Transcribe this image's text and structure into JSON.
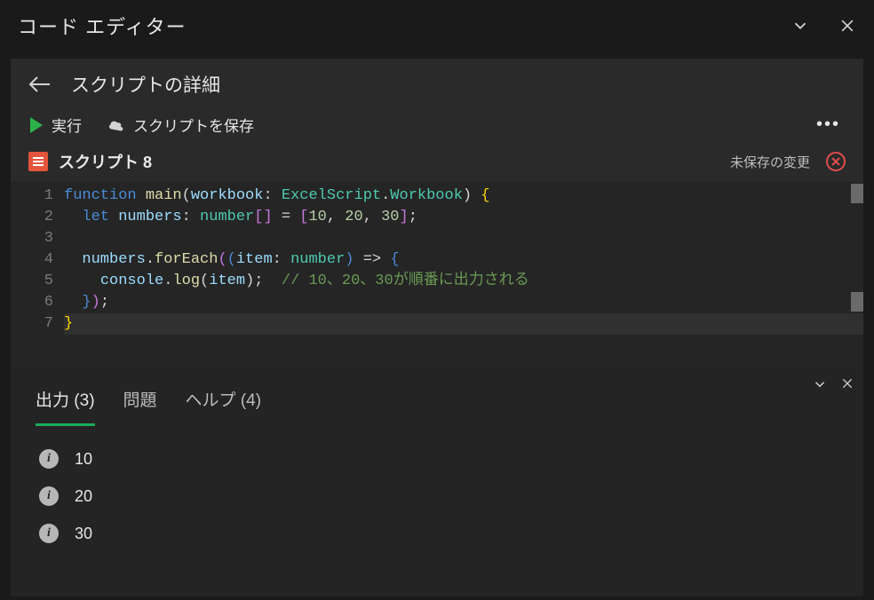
{
  "window": {
    "title": "コード エディター"
  },
  "header": {
    "title": "スクリプトの詳細",
    "run_label": "実行",
    "save_label": "スクリプトを保存"
  },
  "script": {
    "name": "スクリプト 8",
    "unsaved_label": "未保存の変更"
  },
  "code": {
    "line_numbers": [
      "1",
      "2",
      "3",
      "4",
      "5",
      "6",
      "7"
    ],
    "lines": [
      {
        "t": "function main(workbook: ExcelScript.Workbook) {"
      },
      {
        "t": "  let numbers: number[] = [10, 20, 30];"
      },
      {
        "t": ""
      },
      {
        "t": "  numbers.forEach((item: number) => {"
      },
      {
        "t": "    console.log(item);  // 10、20、30が順番に出力される"
      },
      {
        "t": "  });"
      },
      {
        "t": "}"
      }
    ]
  },
  "panel": {
    "tabs": {
      "output": {
        "label": "出力",
        "count": 3
      },
      "problems": {
        "label": "問題"
      },
      "help": {
        "label": "ヘルプ",
        "count": 4
      }
    },
    "output_items": [
      "10",
      "20",
      "30"
    ]
  }
}
